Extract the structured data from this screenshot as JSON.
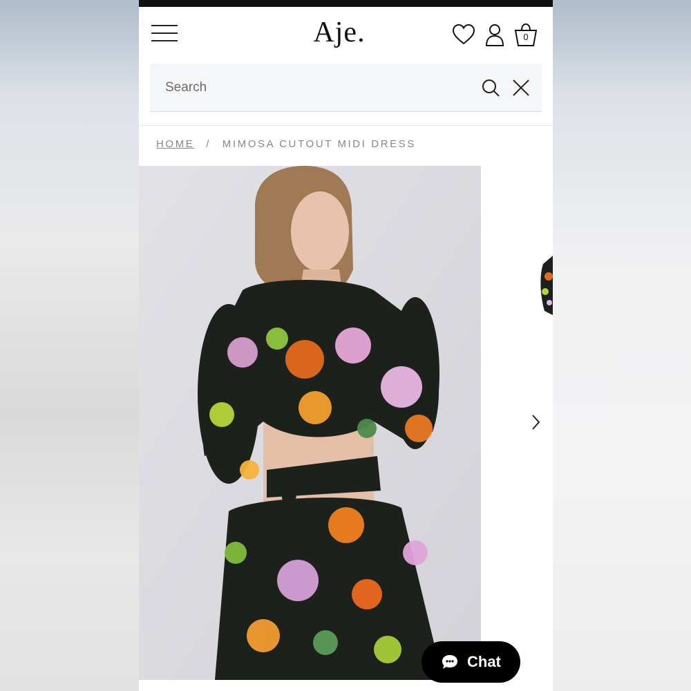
{
  "header": {
    "logo": "Aje.",
    "bag_count": "0"
  },
  "search": {
    "placeholder": "Search"
  },
  "breadcrumb": {
    "home": "HOME",
    "separator": "/",
    "current": "MIMOSA CUTOUT MIDI DRESS"
  },
  "gallery": {
    "image_alt": "Model wearing floral cutout midi dress, back view"
  },
  "chat": {
    "label": "Chat"
  },
  "colors": {
    "ink": "#111111",
    "search_bg": "#f5f6f8",
    "breadcrumb": "#888888",
    "chat_bg": "#000000"
  },
  "icons": [
    "menu-icon",
    "heart-icon",
    "user-icon",
    "bag-icon",
    "search-icon",
    "close-icon",
    "chevron-right-icon",
    "chat-bubble-icon"
  ]
}
